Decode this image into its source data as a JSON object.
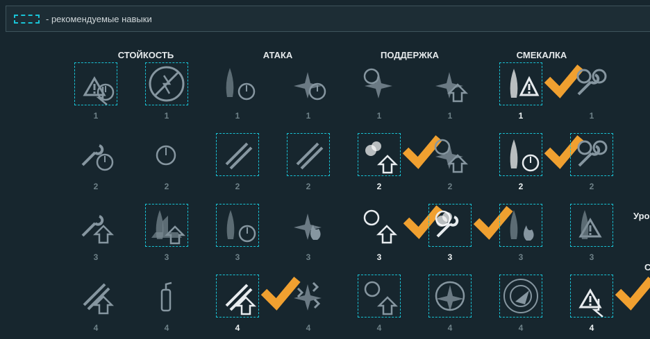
{
  "legend": {
    "text": "- рекомендуемые навыки"
  },
  "categories": [
    "СТОЙКОСТЬ",
    "АТАКА",
    "ПОДДЕРЖКА",
    "СМЕКАЛКА"
  ],
  "side_labels": [
    "Уро",
    "С"
  ],
  "colors": {
    "accent": "#19c3d6",
    "check": "#f0a030",
    "dim": "#6e8188",
    "bright": "#eef2f3"
  },
  "rows": [
    {
      "skills": [
        {
          "icon": "warning-cooldown-icon",
          "level": "1",
          "recommended": true,
          "learned": false,
          "active": false
        },
        {
          "icon": "no-fire-icon",
          "level": "1",
          "recommended": true,
          "learned": false,
          "active": false
        },
        {
          "icon": "torpedo-timer-icon",
          "level": "1",
          "recommended": false,
          "learned": false,
          "active": false
        },
        {
          "icon": "plane-timer-icon",
          "level": "1",
          "recommended": false,
          "learned": false,
          "active": false
        },
        {
          "icon": "planes-target-icon",
          "level": "1",
          "recommended": false,
          "learned": false,
          "active": false
        },
        {
          "icon": "plane-upgrade-icon",
          "level": "1",
          "recommended": false,
          "learned": false,
          "active": false
        },
        {
          "icon": "ship-warning-icon",
          "level": "1",
          "recommended": true,
          "learned": true,
          "active": true
        },
        {
          "icon": "bomb-repair-icon",
          "level": "1",
          "recommended": false,
          "learned": false,
          "active": false
        }
      ]
    },
    {
      "skills": [
        {
          "icon": "wrench-timer-icon",
          "level": "2",
          "recommended": false,
          "learned": false,
          "active": false
        },
        {
          "icon": "stopwatch-icon",
          "level": "2",
          "recommended": false,
          "learned": false,
          "active": false
        },
        {
          "icon": "turret-icon",
          "level": "2",
          "recommended": true,
          "learned": false,
          "active": false
        },
        {
          "icon": "gun-barrel-icon",
          "level": "2",
          "recommended": true,
          "learned": false,
          "active": false
        },
        {
          "icon": "smoke-upgrade-icon",
          "level": "2",
          "recommended": true,
          "learned": true,
          "active": true
        },
        {
          "icon": "plane-target-upgrade-icon",
          "level": "2",
          "recommended": false,
          "learned": false,
          "active": false
        },
        {
          "icon": "ships-timer-icon",
          "level": "2",
          "recommended": true,
          "learned": true,
          "active": true
        },
        {
          "icon": "propeller-wrench-icon",
          "level": "2",
          "recommended": true,
          "learned": false,
          "active": false
        }
      ]
    },
    {
      "skills": [
        {
          "icon": "wrench-upgrade-icon",
          "level": "3",
          "recommended": false,
          "learned": false,
          "active": false
        },
        {
          "icon": "battleship-upgrade-icon",
          "level": "3",
          "recommended": true,
          "learned": false,
          "active": false
        },
        {
          "icon": "torpedoes-timer-icon",
          "level": "3",
          "recommended": true,
          "learned": false,
          "active": false
        },
        {
          "icon": "plane-fire-icon",
          "level": "3",
          "recommended": false,
          "learned": false,
          "active": false
        },
        {
          "icon": "targets-upgrade-icon",
          "level": "3",
          "recommended": false,
          "learned": true,
          "active": true
        },
        {
          "icon": "target-repair-smoke-icon",
          "level": "3",
          "recommended": true,
          "learned": true,
          "active": true
        },
        {
          "icon": "ship-fire-icon",
          "level": "3",
          "recommended": true,
          "learned": false,
          "active": false
        },
        {
          "icon": "torpedo-warning-icon",
          "level": "3",
          "recommended": true,
          "learned": false,
          "active": false
        }
      ]
    },
    {
      "skills": [
        {
          "icon": "shells-upgrade-icon",
          "level": "4",
          "recommended": false,
          "learned": false,
          "active": false
        },
        {
          "icon": "extinguisher-icon",
          "level": "4",
          "recommended": false,
          "learned": false,
          "active": false
        },
        {
          "icon": "crossed-shells-upgrade-icon",
          "level": "4",
          "recommended": true,
          "learned": true,
          "active": true
        },
        {
          "icon": "plane-squadron-icon",
          "level": "4",
          "recommended": false,
          "learned": false,
          "active": false
        },
        {
          "icon": "targets-double-upgrade-icon",
          "level": "4",
          "recommended": true,
          "learned": false,
          "active": false
        },
        {
          "icon": "crosshair-plane-icon",
          "level": "4",
          "recommended": true,
          "learned": false,
          "active": false
        },
        {
          "icon": "radar-icon",
          "level": "4",
          "recommended": true,
          "learned": false,
          "active": false
        },
        {
          "icon": "warning-down-icon",
          "level": "4",
          "recommended": true,
          "learned": true,
          "active": true
        }
      ]
    }
  ]
}
